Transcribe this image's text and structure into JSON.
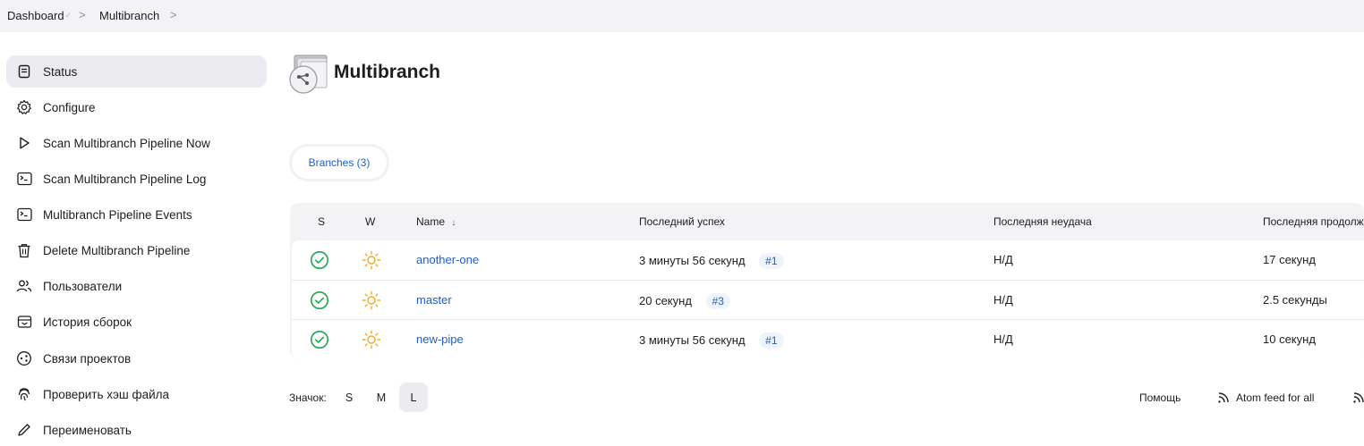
{
  "breadcrumb": {
    "items": [
      "Dashboard",
      "Multibranch"
    ],
    "separator": ">"
  },
  "sidebar": {
    "items": [
      {
        "label": "Status",
        "icon": "document-icon",
        "active": true
      },
      {
        "label": "Configure",
        "icon": "gear-icon"
      },
      {
        "label": "Scan Multibranch Pipeline Now",
        "icon": "play-icon"
      },
      {
        "label": "Scan Multibranch Pipeline Log",
        "icon": "terminal-icon"
      },
      {
        "label": "Multibranch Pipeline Events",
        "icon": "terminal-icon"
      },
      {
        "label": "Delete Multibranch Pipeline",
        "icon": "trash-icon"
      },
      {
        "label": "Пользователи",
        "icon": "users-icon"
      },
      {
        "label": "История сборок",
        "icon": "build-history-icon"
      },
      {
        "label": "Связи проектов",
        "icon": "project-relations-icon"
      },
      {
        "label": "Проверить хэш файла",
        "icon": "fingerprint-icon"
      },
      {
        "label": "Переименовать",
        "icon": "pencil-icon"
      }
    ]
  },
  "main": {
    "title": "Multibranch",
    "tab_label": "Branches (3)"
  },
  "table": {
    "headers": {
      "s": "S",
      "w": "W",
      "name": "Name",
      "sort_indicator": "↓",
      "last_success": "Последний успех",
      "last_failure": "Последняя неудача",
      "last_duration": "Последняя продолж"
    },
    "rows": [
      {
        "status": "success",
        "weather": "sunny",
        "name": "another-one",
        "last_success": "3 минуты 56 секунд",
        "build": "#1",
        "last_failure": "Н/Д",
        "duration": "17 секунд"
      },
      {
        "status": "success",
        "weather": "sunny",
        "name": "master",
        "last_success": "20 секунд",
        "build": "#3",
        "last_failure": "Н/Д",
        "duration": "2.5 секунды"
      },
      {
        "status": "success",
        "weather": "sunny",
        "name": "new-pipe",
        "last_success": "3 минуты 56 секунд",
        "build": "#1",
        "last_failure": "Н/Д",
        "duration": "10 секунд"
      }
    ]
  },
  "footer": {
    "icon_label": "Значок:",
    "sizes": [
      "S",
      "M",
      "L"
    ],
    "selected_size": "L",
    "help_label": "Помощь",
    "atom_all_label": "Atom feed for all"
  },
  "colors": {
    "link": "#1f5fc7",
    "success": "#1ea64b",
    "sunny": "#f2a91e",
    "surface": "#f3f3f6"
  }
}
